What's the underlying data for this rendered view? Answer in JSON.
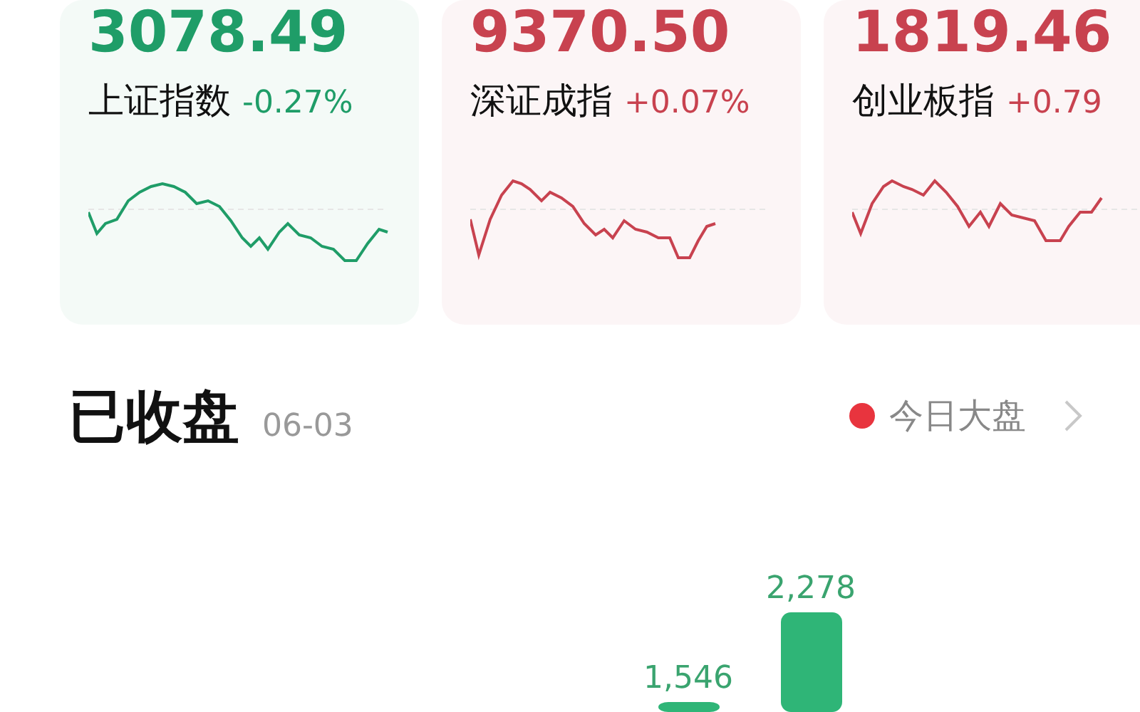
{
  "indices": [
    {
      "value": "3078.49",
      "name": "上证指数",
      "change": "-0.27%",
      "color": "#1f9d68"
    },
    {
      "value": "9370.50",
      "name": "深证成指",
      "change": "+0.07%",
      "color": "#c8424f"
    },
    {
      "value": "1819.46",
      "name": "创业板指",
      "change": "+0.79",
      "color": "#c8424f"
    }
  ],
  "section": {
    "title": "已收盘",
    "date": "06-03",
    "link": "今日大盘"
  },
  "bars": [
    {
      "label": "1,546"
    },
    {
      "label": "2,278"
    }
  ]
}
